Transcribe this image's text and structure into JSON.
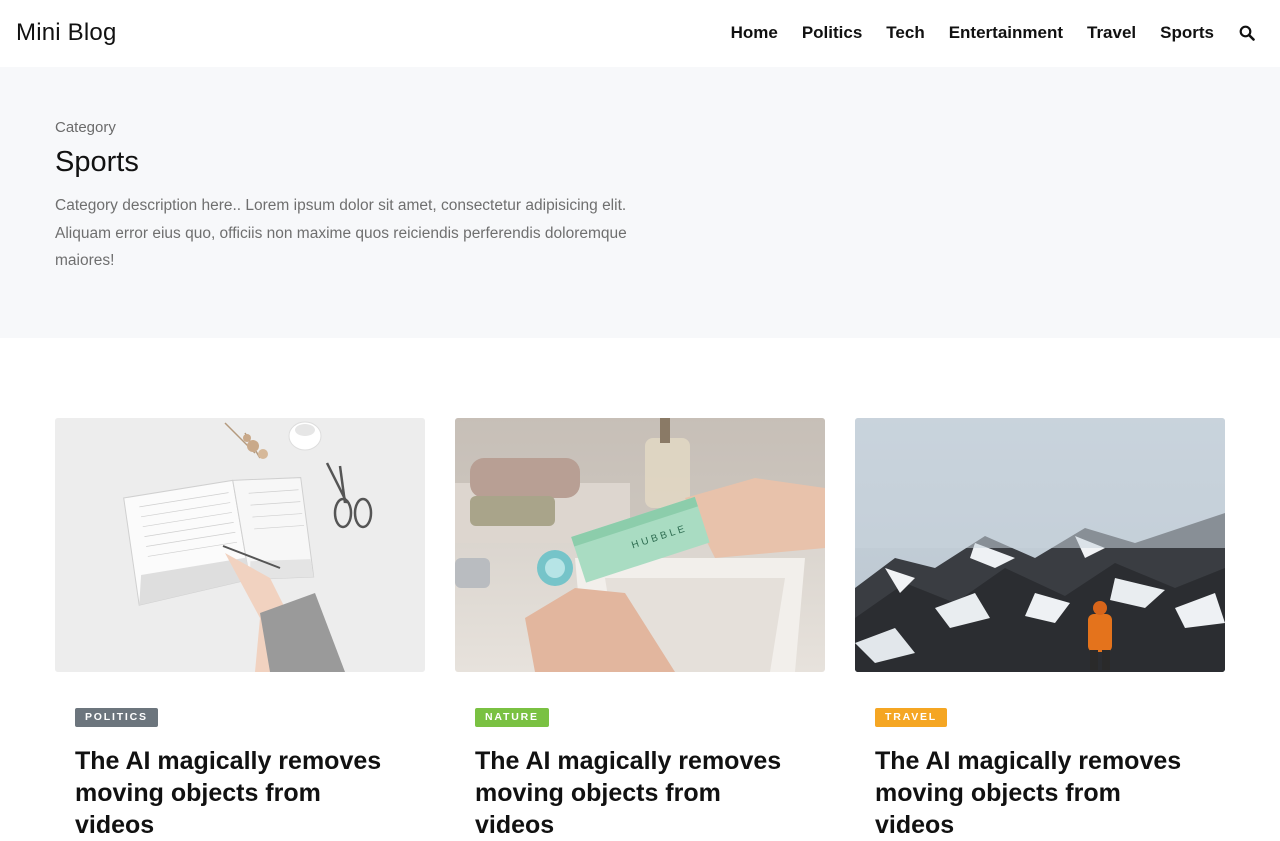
{
  "header": {
    "brand": "Mini Blog",
    "nav": [
      "Home",
      "Politics",
      "Tech",
      "Entertainment",
      "Travel",
      "Sports"
    ]
  },
  "hero": {
    "eyebrow": "Category",
    "title": "Sports",
    "description": "Category description here.. Lorem ipsum dolor sit amet, consectetur adipisicing elit. Aliquam error eius quo, officiis non maxime quos reiciendis perferendis doloremque maiores!"
  },
  "posts": [
    {
      "tag": "POLITICS",
      "tag_color": "#6c757d",
      "title": "The AI magically removes moving objects from videos"
    },
    {
      "tag": "NATURE",
      "tag_color": "#7ac142",
      "title": "The AI magically removes moving objects from videos"
    },
    {
      "tag": "TRAVEL",
      "tag_color": "#f5a623",
      "title": "The AI magically removes moving objects from videos"
    }
  ]
}
